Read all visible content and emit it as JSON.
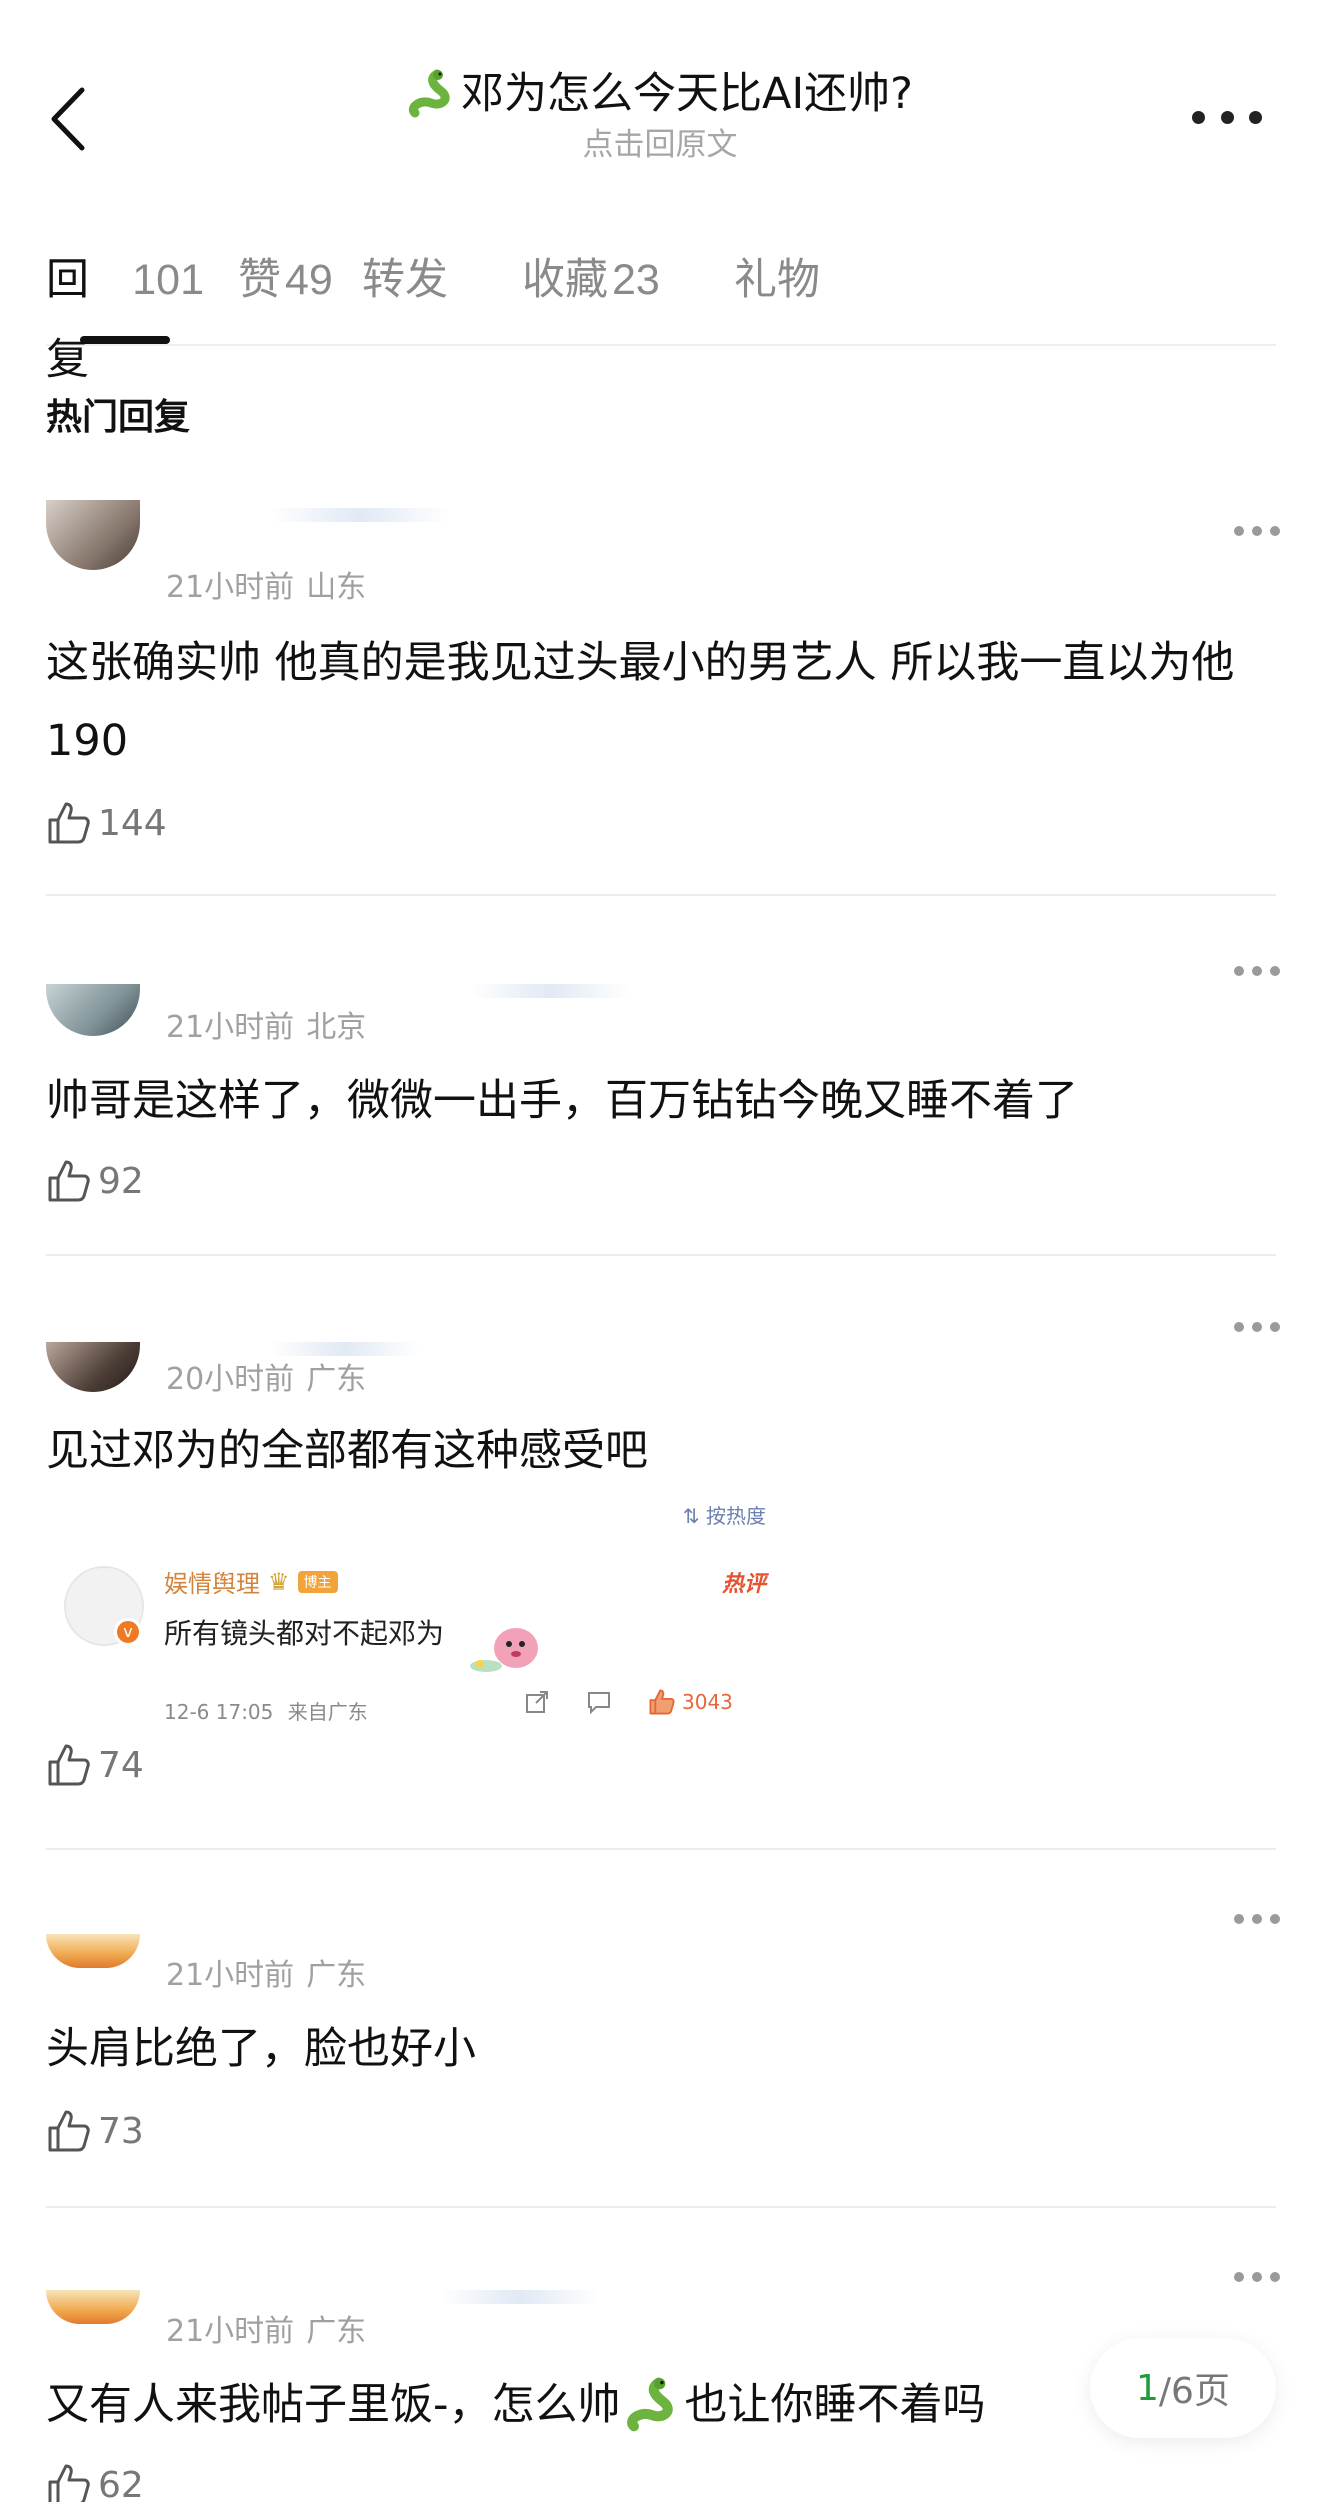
{
  "header": {
    "title": "邓为怎么今天比AI还帅?",
    "title_emoji": "snake-emoji",
    "subtitle": "点击回原文"
  },
  "tabs": [
    {
      "label": "回复",
      "count": "101",
      "active": true
    },
    {
      "label": "赞",
      "count": "49",
      "active": false
    },
    {
      "label": "转发",
      "count": "",
      "active": false
    },
    {
      "label": "收藏",
      "count": "23",
      "active": false
    },
    {
      "label": "礼物",
      "count": "",
      "active": false
    }
  ],
  "section": {
    "title": "热门回复"
  },
  "comments": [
    {
      "time": "21小时前",
      "location": "山东",
      "text": "这张确实帅 他真的是我见过头最小的男艺人 所以我一直以为他190",
      "likes": "144"
    },
    {
      "time": "21小时前",
      "location": "北京",
      "text": "帅哥是这样了，微微一出手，百万钻钻今晚又睡不着了",
      "likes": "92"
    },
    {
      "time": "20小时前",
      "location": "广东",
      "text": "见过邓为的全部都有这种感受吧",
      "likes": "74"
    },
    {
      "time": "21小时前",
      "location": "广东",
      "text": "头肩比绝了，脸也好小",
      "likes": "73"
    },
    {
      "time": "21小时前",
      "location": "广东",
      "text": "又有人来我帖子里饭-，怎么帅",
      "text_after": "也让你睡不着吗",
      "likes": "62"
    }
  ],
  "embed": {
    "sort_label": "按热度",
    "user_name": "娱情舆理",
    "user_tag": "博主",
    "hot_label": "热评",
    "text": "所有镜头都对不起邓为",
    "date": "12-6 17:05",
    "source": "来自广东",
    "likes": "3043"
  },
  "pager": {
    "current": "1",
    "total": "/6页"
  },
  "colors": {
    "accent_green": "#1f9d3a",
    "hot_red": "#e8532f",
    "muted": "#a0a0a0"
  }
}
